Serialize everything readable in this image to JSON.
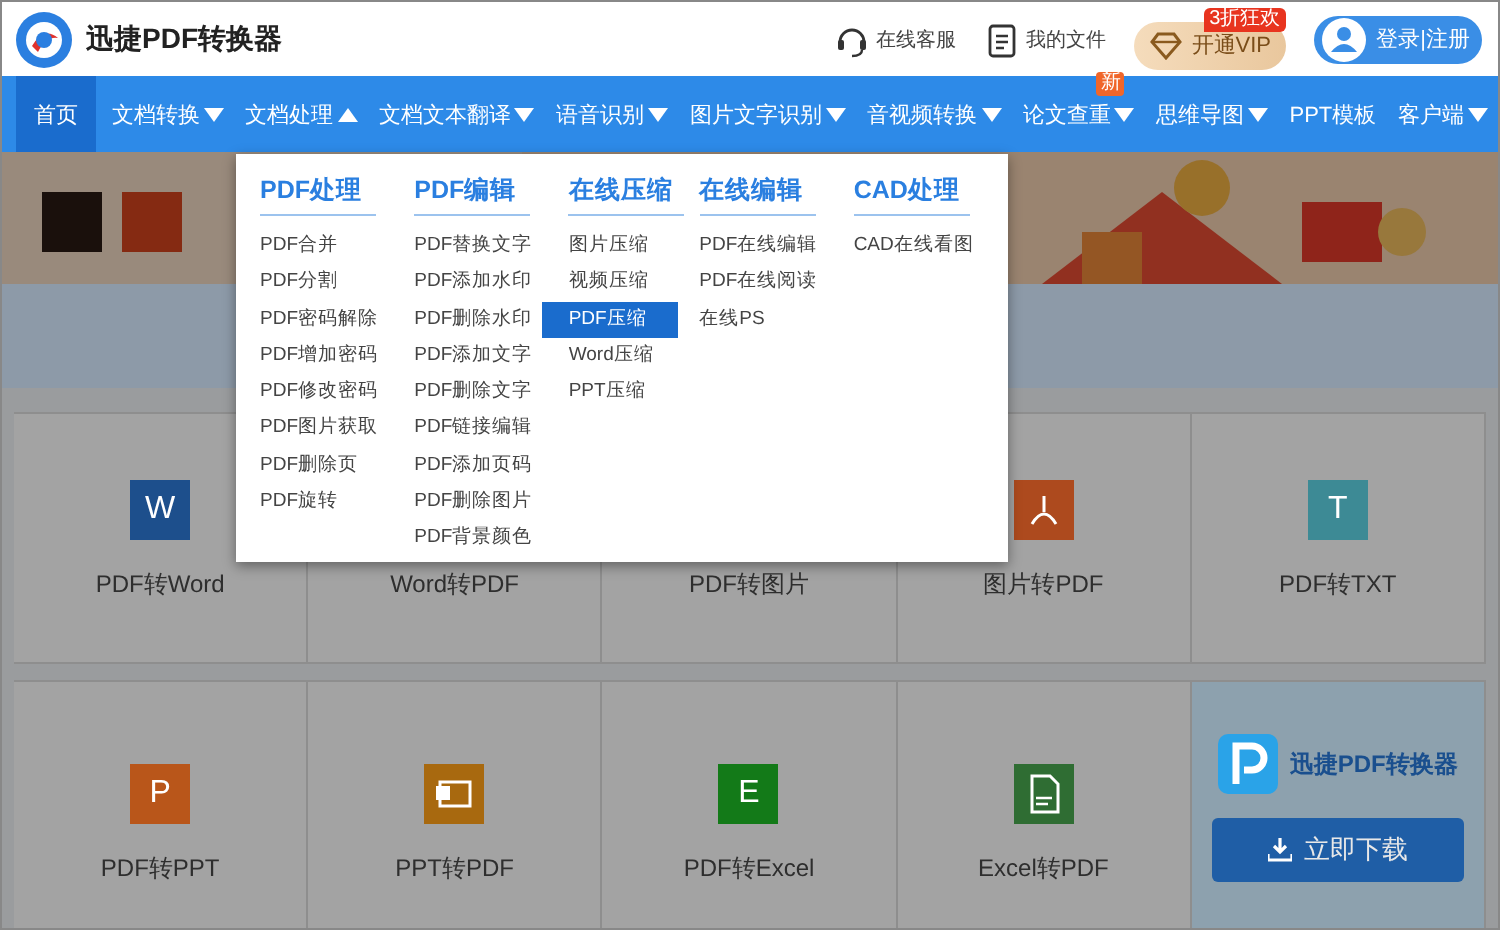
{
  "header": {
    "app_name": "迅捷PDF转换器",
    "links": [
      {
        "kind": "support",
        "label": "在线客服"
      },
      {
        "kind": "files",
        "label": "我的文件"
      }
    ],
    "vip": {
      "label": "开通VIP",
      "badge": "3折狂欢"
    },
    "login": {
      "label": "登录|注册"
    }
  },
  "nav": [
    {
      "label": "首页",
      "selected": true
    },
    {
      "label": "文档转换",
      "selected": false,
      "expanded": false
    },
    {
      "label": "文档处理",
      "selected": false,
      "expanded": true
    },
    {
      "label": "文档文本翻译",
      "selected": false,
      "expanded": false
    },
    {
      "label": "语音识别",
      "selected": false,
      "expanded": false
    },
    {
      "label": "图片文字识别",
      "selected": false,
      "expanded": false
    },
    {
      "label": "音视频转换",
      "selected": false,
      "expanded": false
    },
    {
      "label": "论文查重",
      "selected": false,
      "expanded": false,
      "badge": "新"
    },
    {
      "label": "思维导图",
      "selected": false,
      "expanded": false
    },
    {
      "label": "PPT模板",
      "selected": false
    },
    {
      "label": "客户端",
      "selected": false,
      "expanded": false
    }
  ],
  "dropdown": [
    {
      "heading": "PDF处理",
      "items": [
        {
          "label": "PDF合并",
          "selected": false
        },
        {
          "label": "PDF分割",
          "selected": false
        },
        {
          "label": "PDF密码解除",
          "selected": false
        },
        {
          "label": "PDF增加密码",
          "selected": false
        },
        {
          "label": "PDF修改密码",
          "selected": false
        },
        {
          "label": "PDF图片获取",
          "selected": false
        },
        {
          "label": "PDF删除页",
          "selected": false
        },
        {
          "label": "PDF旋转",
          "selected": false
        }
      ]
    },
    {
      "heading": "PDF编辑",
      "items": [
        {
          "label": "PDF替换文字",
          "selected": false
        },
        {
          "label": "PDF添加水印",
          "selected": false
        },
        {
          "label": "PDF删除水印",
          "selected": false
        },
        {
          "label": "PDF添加文字",
          "selected": false
        },
        {
          "label": "PDF删除文字",
          "selected": false
        },
        {
          "label": "PDF链接编辑",
          "selected": false
        },
        {
          "label": "PDF添加页码",
          "selected": false
        },
        {
          "label": "PDF删除图片",
          "selected": false
        },
        {
          "label": "PDF背景颜色",
          "selected": false
        }
      ]
    },
    {
      "heading": "在线压缩",
      "items": [
        {
          "label": "图片压缩",
          "selected": false
        },
        {
          "label": "视频压缩",
          "selected": false
        },
        {
          "label": "PDF压缩",
          "selected": true
        },
        {
          "label": "Word压缩",
          "selected": false
        },
        {
          "label": "PPT压缩",
          "selected": false
        }
      ]
    },
    {
      "heading": "在线编辑",
      "items": [
        {
          "label": "PDF在线编辑",
          "selected": false
        },
        {
          "label": "PDF在线阅读",
          "selected": false
        },
        {
          "label": "在线PS",
          "selected": false
        }
      ]
    },
    {
      "heading": "CAD处理",
      "items": [
        {
          "label": "CAD在线看图",
          "selected": false
        }
      ]
    }
  ],
  "tools": [
    {
      "label": "PDF转Word",
      "kind": "letter",
      "glyph": "W",
      "color": "#1d4f8c"
    },
    {
      "label": "Word转PDF"
    },
    {
      "label": "PDF转图片"
    },
    {
      "label": "图片转PDF",
      "kind": "pdf",
      "color": "#ad4a1e"
    },
    {
      "label": "PDF转TXT",
      "kind": "letter",
      "glyph": "T",
      "color": "#3d8a95"
    },
    {
      "label": "PDF转PPT",
      "kind": "letter",
      "glyph": "P",
      "color": "#b9561a"
    },
    {
      "label": "PPT转PDF",
      "kind": "slide",
      "color": "#a8690f"
    },
    {
      "label": "PDF转Excel",
      "kind": "letter",
      "glyph": "E",
      "color": "#137a18"
    },
    {
      "label": "Excel转PDF",
      "kind": "doc",
      "color": "#2f6d33"
    }
  ],
  "promo": {
    "app_name": "迅捷PDF转换器",
    "button": "立即下载"
  }
}
